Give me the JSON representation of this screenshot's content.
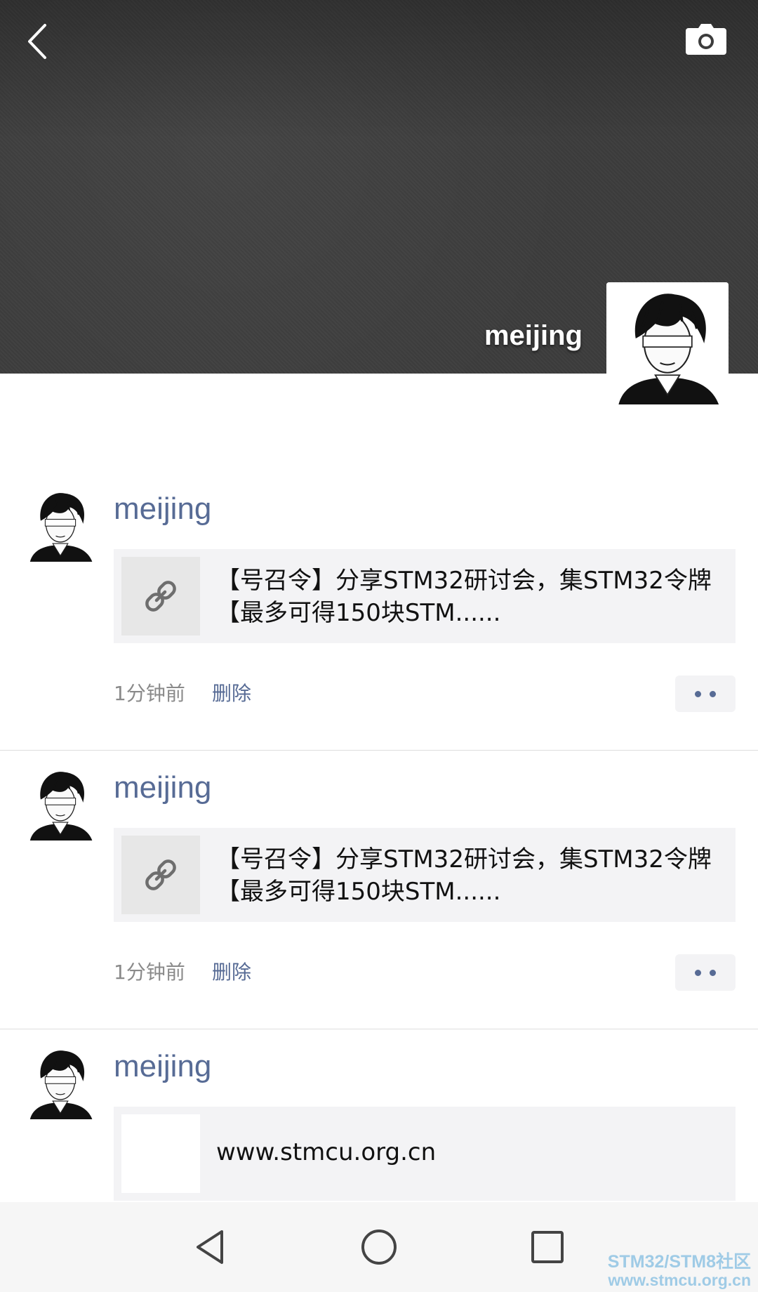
{
  "header": {
    "back_icon": "chevron-left-icon",
    "camera_icon": "camera-icon",
    "user_name": "meijing"
  },
  "posts": [
    {
      "author": "meijing",
      "link_icon": "link-icon",
      "link_title": "【号召令】分享STM32研讨会，集STM32令牌 【最多可得150块STM......",
      "time": "1分钟前",
      "delete_label": "删除",
      "more_icon": "more-dots-icon"
    },
    {
      "author": "meijing",
      "link_icon": "link-icon",
      "link_title": "【号召令】分享STM32研讨会，集STM32令牌 【最多可得150块STM......",
      "time": "1分钟前",
      "delete_label": "删除",
      "more_icon": "more-dots-icon"
    },
    {
      "author": "meijing",
      "link_title": "www.stmcu.org.cn"
    }
  ],
  "navbar": {
    "back_icon": "triangle-back-icon",
    "home_icon": "circle-home-icon",
    "recents_icon": "square-recents-icon"
  },
  "watermark": {
    "line1": "STM32/STM8社区",
    "line2": "www.stmcu.org.cn"
  },
  "colors": {
    "name_link": "#576b95",
    "cover_bg": "#3c3c3c",
    "card_bg": "#f3f3f5"
  }
}
